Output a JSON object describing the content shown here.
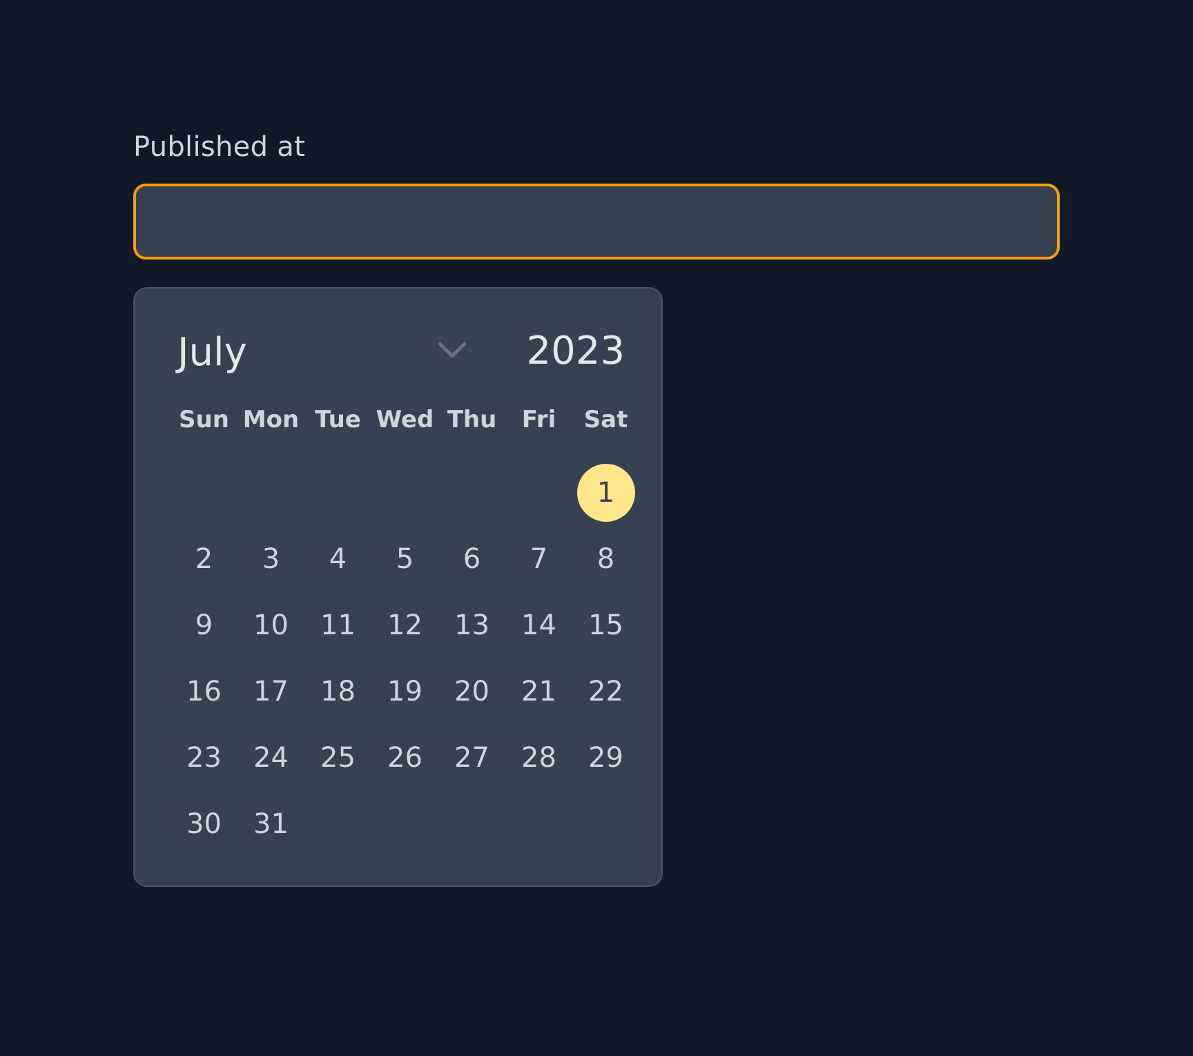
{
  "field": {
    "label": "Published at",
    "value": "",
    "placeholder": ""
  },
  "picker": {
    "month": "July",
    "year": "2023",
    "weekdays": [
      "Sun",
      "Mon",
      "Tue",
      "Wed",
      "Thu",
      "Fri",
      "Sat"
    ],
    "first_weekday_index": 6,
    "days_in_month": 31,
    "selected_day": 1
  },
  "icons": {
    "month_dropdown": "chevron-down-icon"
  },
  "colors": {
    "background": "#111827",
    "panel": "#374151",
    "focus_ring": "#f59e0b",
    "selected_day": "#fde68a",
    "text": "#d1d5db"
  }
}
